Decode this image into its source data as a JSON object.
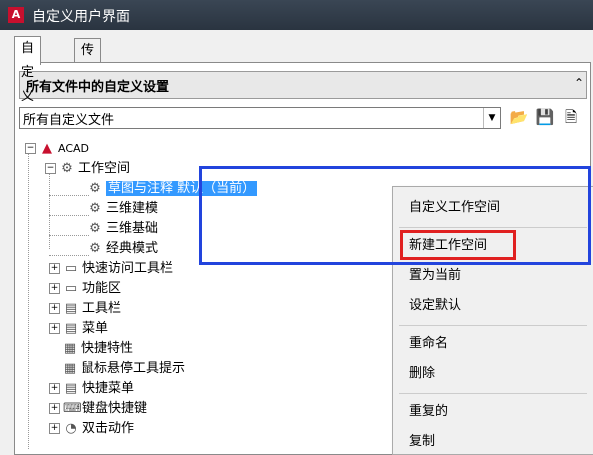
{
  "window": {
    "title": "自定义用户界面"
  },
  "tabs": [
    {
      "label": "自定义"
    },
    {
      "label": "传输"
    }
  ],
  "section": {
    "title": "所有文件中的自定义设置"
  },
  "file_combo": {
    "value": "所有自定义文件"
  },
  "tree": {
    "root": "ACAD",
    "workspaces": {
      "label": "工作空间",
      "children": [
        {
          "label": "草图与注释 默认（当前）"
        },
        {
          "label": "三维建模"
        },
        {
          "label": "三维基础"
        },
        {
          "label": "经典模式"
        }
      ]
    },
    "items": [
      {
        "label": "快速访问工具栏"
      },
      {
        "label": "功能区"
      },
      {
        "label": "工具栏"
      },
      {
        "label": "菜单"
      },
      {
        "label": "快捷特性"
      },
      {
        "label": "鼠标悬停工具提示"
      },
      {
        "label": "快捷菜单"
      },
      {
        "label": "键盘快捷键"
      },
      {
        "label": "双击动作"
      }
    ]
  },
  "context_menu": {
    "items": [
      {
        "label": "自定义工作空间"
      },
      {
        "label": "新建工作空间"
      },
      {
        "label": "置为当前"
      },
      {
        "label": "设定默认"
      },
      {
        "label": "重命名"
      },
      {
        "label": "删除"
      },
      {
        "label": "重复的"
      },
      {
        "label": "复制"
      }
    ]
  },
  "annotations": {
    "blue_box_color": "#2244dd",
    "red_box_color": "#e02020"
  },
  "icons": [
    "autocad-app-icon",
    "chevron-up-icon",
    "dropdown-arrow-icon",
    "open-folder-icon",
    "save-icon",
    "save-as-icon",
    "gear-icon",
    "expand-icon",
    "collapse-icon"
  ]
}
